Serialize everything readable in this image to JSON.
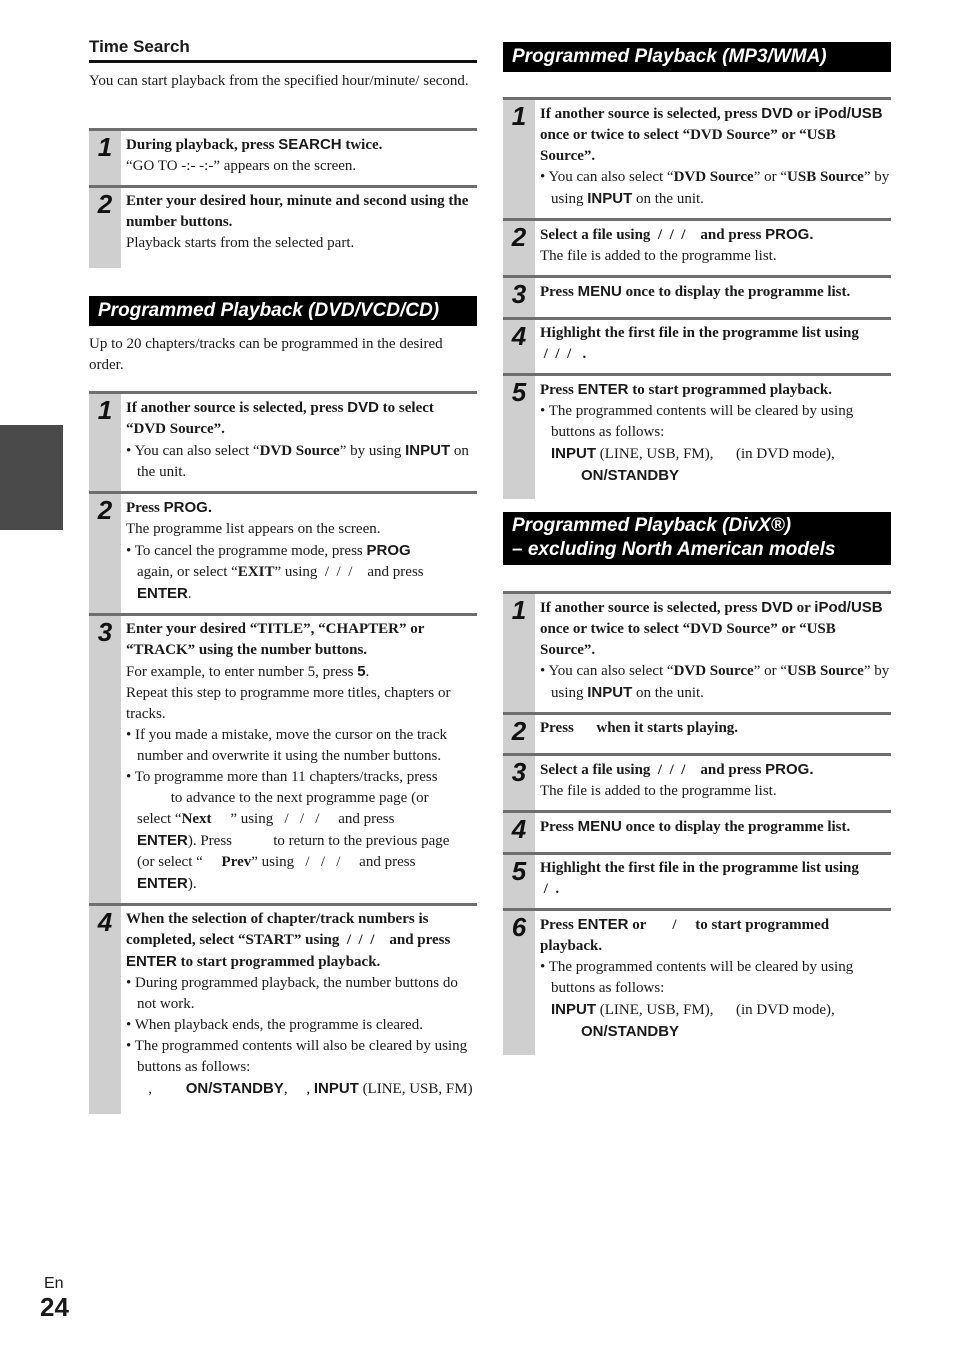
{
  "page": {
    "lang": "En",
    "number": "24"
  },
  "time_search": {
    "title": "Time Search",
    "intro": "You can start playback from the specified hour/minute/ second.",
    "steps": [
      {
        "n": "1",
        "head_a": "During playback, press ",
        "key": "SEARCH",
        "head_b": " twice.",
        "text": "“GO TO -:- -:-” appears on the screen."
      },
      {
        "n": "2",
        "head": "Enter your desired hour, minute and second using the number buttons.",
        "text": "Playback starts from the selected part."
      }
    ]
  },
  "dvd": {
    "title": "Programmed Playback (DVD/VCD/CD)",
    "intro": "Up to 20 chapters/tracks can be programmed in the desired order.",
    "s1": {
      "n": "1",
      "head_a": "If another source is selected, press ",
      "key": "DVD",
      "head_b": " to select “DVD Source”.",
      "bul_a": "• You can also select “",
      "bul_b": "DVD Source",
      "bul_c": "” by using ",
      "bul_key": "INPUT",
      "bul_d": " on the unit."
    },
    "s2": {
      "n": "2",
      "head_a": "Press ",
      "key": "PROG.",
      "text": "The programme list appears on the screen.",
      "bul_a": "• To cancel the programme mode, press ",
      "bul_key": "PROG",
      "bul_b": "again, or select “",
      "bul_exit": "EXIT",
      "bul_c": "” using  /  /  /    and press ",
      "enter": "ENTER",
      "dot": "."
    },
    "s3": {
      "n": "3",
      "head": "Enter your desired “TITLE”, “CHAPTER” or “TRACK” using the number buttons.",
      "t1_a": "For example, to enter number 5, press ",
      "t1_key": "5",
      "t1_b": ".",
      "t2": "Repeat this step to programme more titles, chapters or tracks.",
      "b1": "• If you made a mistake, move the cursor on the track number and overwrite it using the number buttons.",
      "b2_a": "• To programme more than 11 chapters/tracks, press",
      "b2_b": "         to advance to the next programme page (or",
      "b2_c": "select “",
      "b2_next": "Next",
      "b2_d": "     ” using   /   /   /     and press",
      "b2_enter": "ENTER",
      "b2_e": "). Press           to return to the previous page",
      "b2_f": "(or select “     ",
      "b2_prev": "Prev",
      "b2_g": "” using   /   /   /     and press",
      "b2_enter2": "ENTER",
      "b2_h": ")."
    },
    "s4": {
      "n": "4",
      "head_a": "When the selection of chapter/track numbers is completed, select “START” using  /  /  /    and press ",
      "key": "ENTER",
      "head_b": " to start programmed playback.",
      "b1": "• During programmed playback, the number buttons do not work.",
      "b2": "• When playback ends, the programme is cleared.",
      "b3": "• The programmed contents will also be cleared by using buttons as follows:",
      "l_a": "   ,         ",
      "l_key1": "ON/STANDBY",
      "l_b": ",     , ",
      "l_key2": "INPUT",
      "l_c": " (LINE, USB, FM)"
    }
  },
  "mp3": {
    "title": "Programmed Playback (MP3/WMA)",
    "s1": {
      "n": "1",
      "head_a": "If another source is selected, press ",
      "key1": "DVD",
      "head_b": " or ",
      "key2": "iPod/USB",
      "head_c": " once or twice to select “DVD Source” or “USB Source”.",
      "bul_a": "• You can also select “",
      "bul_b": "DVD Source",
      "bul_c": "” or “",
      "bul_d": "USB Source",
      "bul_e": "” by using ",
      "bul_key": "INPUT",
      "bul_f": " on the unit."
    },
    "s2": {
      "n": "2",
      "head_a": "Select a file using  /  /  /    and press ",
      "key": "PROG.",
      "text": "The file is added to the programme list."
    },
    "s3": {
      "n": "3",
      "head_a": "Press ",
      "key": "MENU",
      "head_b": " once to display the programme list."
    },
    "s4": {
      "n": "4",
      "head": "Highlight the first file in the programme list using",
      "head2": " /  /  /   ."
    },
    "s5": {
      "n": "5",
      "head_a": "Press ",
      "key": "ENTER",
      "head_b": " to start programmed playback.",
      "b1": "• The programmed contents will be cleared by using buttons as follows:",
      "l_key": "INPUT",
      "l_a": " (LINE, USB, FM),      (in DVD mode),",
      "l_key2": "ON/STANDBY"
    }
  },
  "divx": {
    "title_l1": "Programmed Playback (DivX®)",
    "title_l2": "– excluding North American models",
    "s1": {
      "n": "1",
      "head_a": "If another source is selected, press ",
      "key1": "DVD",
      "head_b": " or ",
      "key2": "iPod/USB",
      "head_c": " once or twice to select “DVD Source” or “USB Source”.",
      "bul_a": "• You can also select “",
      "bul_b": "DVD Source",
      "bul_c": "” or “",
      "bul_d": "USB Source",
      "bul_e": "” by using ",
      "bul_key": "INPUT",
      "bul_f": " on the unit."
    },
    "s2": {
      "n": "2",
      "head": "Press      when it starts playing."
    },
    "s3": {
      "n": "3",
      "head_a": "Select a file using  /  /  /    and press ",
      "key": "PROG.",
      "text": "The file is added to the programme list."
    },
    "s4": {
      "n": "4",
      "head_a": "Press ",
      "key": "MENU",
      "head_b": " once to display the programme list."
    },
    "s5": {
      "n": "5",
      "head": "Highlight the first file in the programme list using",
      "head2": " /  ."
    },
    "s6": {
      "n": "6",
      "head_a": "Press ",
      "key": "ENTER",
      "head_b": " or       /     to start programmed playback.",
      "b1": "• The programmed contents will be cleared by using buttons as follows:",
      "l_key": "INPUT",
      "l_a": " (LINE, USB, FM),      (in DVD mode),",
      "l_key2": "ON/STANDBY"
    }
  }
}
